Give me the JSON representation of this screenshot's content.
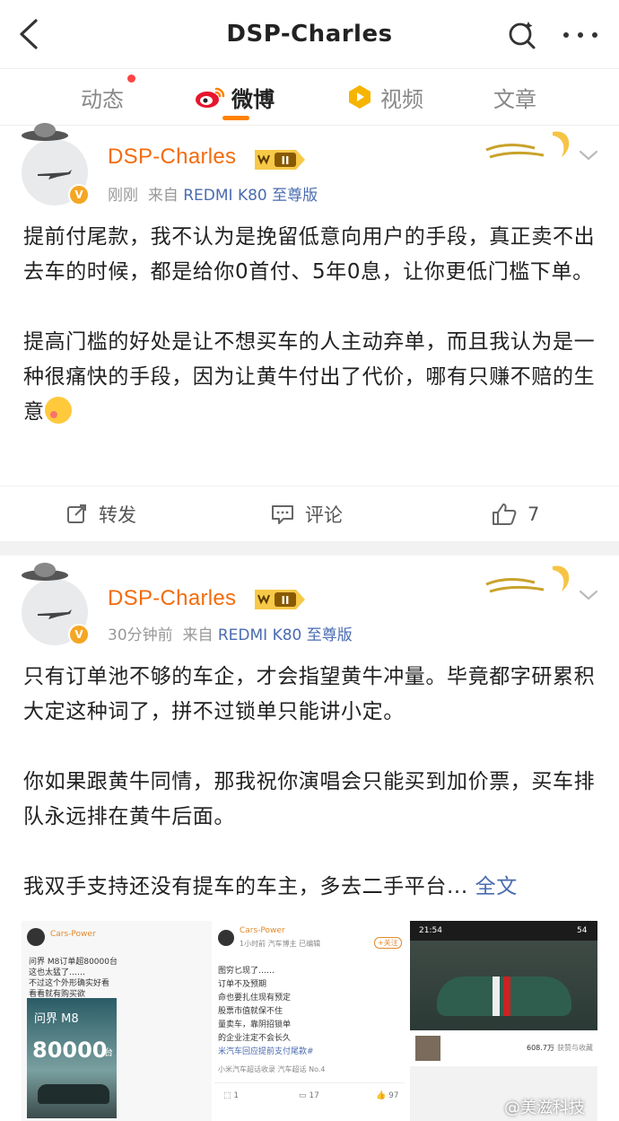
{
  "topbar": {
    "title": "DSP-Charles"
  },
  "tabs": [
    {
      "label": "动态"
    },
    {
      "label": "微博"
    },
    {
      "label": "视频"
    },
    {
      "label": "文章"
    }
  ],
  "posts": [
    {
      "author": "DSP-Charles",
      "vip_level": "II",
      "time": "刚刚",
      "source_prefix": "来自",
      "source": "REDMI K80 至尊版",
      "paragraphs": [
        "提前付尾款，我不认为是挽留低意向用户的手段，真正卖不出去车的时候，都是给你0首付、5年0息，让你更低门槛下单。",
        "提高门槛的好处是让不想买车的人主动弃单，而且我认为是一种很痛快的手段，因为让黄牛付出了代价，哪有只赚不赔的生意"
      ],
      "actions": {
        "repost": "转发",
        "comment": "评论",
        "likes": "7"
      }
    },
    {
      "author": "DSP-Charles",
      "vip_level": "II",
      "time": "30分钟前",
      "source_prefix": "来自",
      "source": "REDMI K80 至尊版",
      "paragraphs": [
        "只有订单池不够的车企，才会指望黄牛冲量。毕竟都字研累积大定这种词了，拼不过锁单只能讲小定。",
        "你如果跟黄牛同情，那我祝你演唱会只能买到加价票，买车排队永远排在黄牛后面。",
        "我双手支持还没有提车的车主，多去二手平台..."
      ],
      "fulltext": "全文"
    }
  ],
  "thumbnails": {
    "t1": {
      "user": "Cars-Power",
      "lines": [
        "问界 M8订单超80000台",
        "这也太猛了……",
        "不过这个外形确实好看",
        "看看就有购买欲"
      ],
      "brand": "问界 M8",
      "big_number": "80000",
      "unit": "台"
    },
    "t2": {
      "user": "Cars-Power",
      "meta": "1小时前  汽车博主 已编辑",
      "follow": "+关注",
      "lines": [
        "图穷匕现了……",
        "订单不及预期",
        "命也要扎住现有预定",
        "股票市值就保不住",
        "量卖车，靠阴招锁单",
        "的企业注定不会长久"
      ],
      "hashtag": "米汽车回应提前支付尾款#",
      "footer": "小米汽车超话收录   汽车超话 No.4",
      "counts": {
        "repost": "1",
        "comment": "17",
        "like": "97"
      }
    },
    "t3": {
      "time": "21:54",
      "battery": "54",
      "stats": [
        "608.7万",
        "获赞与收藏"
      ]
    }
  },
  "watermark": "@美滋科技"
}
